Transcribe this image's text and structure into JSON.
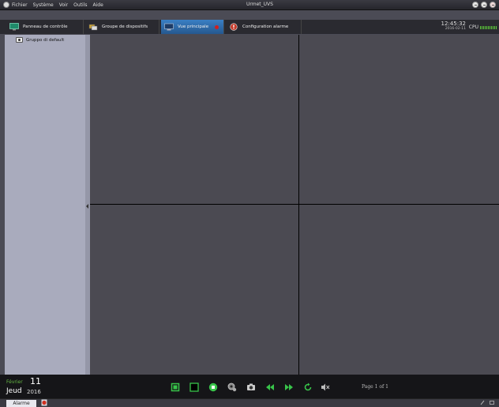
{
  "window": {
    "title": "Urmet_UVS",
    "menu": [
      "Fichier",
      "Système",
      "Voir",
      "Outils",
      "Aide"
    ]
  },
  "tabs": [
    {
      "label": "Panneau de contrôle",
      "icon": "monitor-panel-icon",
      "active": false
    },
    {
      "label": "Groupe de dispositifs",
      "icon": "device-group-icon",
      "active": false
    },
    {
      "label": "Vue principale",
      "icon": "main-view-icon",
      "active": true
    },
    {
      "label": "Configuration alarme",
      "icon": "alarm-config-icon",
      "active": false
    }
  ],
  "status": {
    "time": "12:45:32",
    "date": "2016-02-11",
    "cpu_label": "CPU"
  },
  "sidebar": {
    "items": [
      {
        "label": "Gruppo di default",
        "icon": "camera-group-icon"
      }
    ]
  },
  "date_widget": {
    "month": "Février",
    "day": "11",
    "weekday": "Jeud",
    "year": "2016"
  },
  "toolbar": {
    "buttons": [
      "fullscreen-icon",
      "single-view-icon",
      "stop-icon",
      "ptz-settings-icon",
      "snapshot-icon",
      "previous-icon",
      "next-icon",
      "refresh-icon",
      "mute-icon"
    ],
    "page_info": "Page 1 of 1"
  },
  "statusbar": {
    "alarm_tab": "Alarme"
  },
  "colors": {
    "accent": "#2f6fb0",
    "cell_bg": "#4b4a52",
    "sidebar_bg": "#a9abbd",
    "toolbar_green": "#38c44a"
  }
}
